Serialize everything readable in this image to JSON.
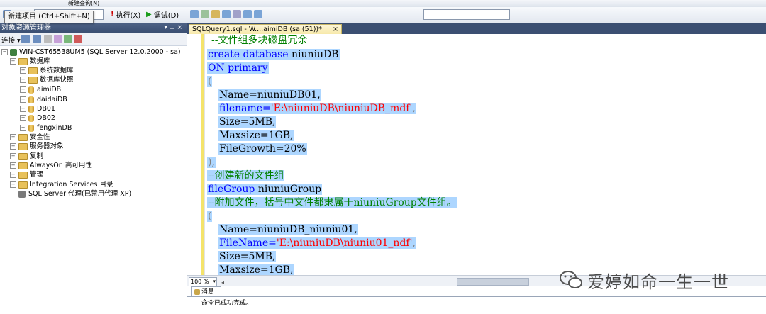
{
  "toolbar": {
    "new_query_label": "新建查询(N)",
    "execute_label": "执行(X)",
    "debug_label": "调试(D)",
    "tooltip": "新建项目 (Ctrl+Shift+N)"
  },
  "object_explorer": {
    "title": "对象资源管理器",
    "pin": "▾ ⊥ ×",
    "connect_label": "连接",
    "server": "WIN-CST65538UM5 (SQL Server 12.0.2000 - sa)",
    "databases_folder": "数据库",
    "system_databases": "系统数据库",
    "database_snapshots": "数据库快照",
    "databases": [
      "aimiDB",
      "daidaiDB",
      "DB01",
      "DB02",
      "fengxinDB"
    ],
    "folders": [
      "安全性",
      "服务器对象",
      "复制",
      "AlwaysOn 高可用性",
      "管理",
      "Integration Services 目录"
    ],
    "agent": "SQL Server 代理(已禁用代理 XP)"
  },
  "editor": {
    "tab_title": "SQLQuery1.sql - W....aimiDB (sa (51))*",
    "tab_close": "×",
    "code": {
      "l1": "--文件组多块磁盘冗余",
      "l2_kw": "create database",
      "l2_name": " niuniuDB",
      "l3_kw": "ON primary",
      "l4": "(",
      "l5": "Name=niuniuDB01,",
      "l6_kw": "filename=",
      "l6_str": "'E:\\niuniuDB\\niuniuDB_mdf'",
      "l6_end": ",",
      "l7": "Size=5MB,",
      "l8": "Maxsize=1GB,",
      "l9": "FileGrowth=20%",
      "l10": "),",
      "l11": "--创建新的文件组",
      "l12_kw": "fileGroup",
      "l12_name": " niuniuGroup",
      "l13": "--附加文件，括号中文件都隶属于niuniuGroup文件组。",
      "l14": "(",
      "l15": "Name=niuniuDB_niuniu01,",
      "l16_kw": "FileName=",
      "l16_str": "'E:\\niuniuDB\\niuniu01_ndf'",
      "l16_end": ",",
      "l17": "Size=5MB,",
      "l18": "Maxsize=1GB,"
    }
  },
  "status": {
    "zoom": "100 %",
    "results_tab": "消息",
    "message": "命令已成功完成。"
  },
  "watermark": "爱婷如命一生一世"
}
